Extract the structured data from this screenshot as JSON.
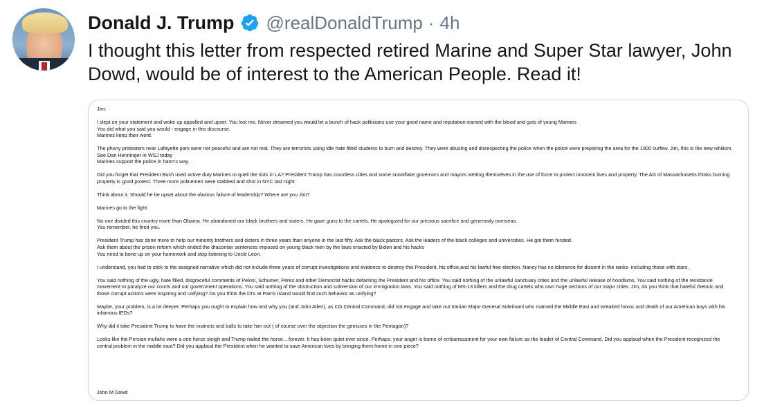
{
  "tweet": {
    "author_name": "Donald J. Trump",
    "handle": "@realDonaldTrump",
    "separator": "·",
    "time": "4h",
    "text": "I thought this letter from respected retired Marine and Super Star lawyer, John Dowd, would be of interest to the American People. Read it!",
    "verified_color": "#1da1f2"
  },
  "letter": {
    "paragraphs": [
      [
        "Jim:"
      ],
      [
        "I slept on your statement and woke up appalled and upset. You lost me. Never dreamed you would let a bunch of hack politicians use your good name and reputation-earned with the blood and guts of young Marines",
        "You did what you said you would - engage in this discourse.",
        "Marines keep their word."
      ],
      [
        "The phony protesters near Lafayette park were not peaceful and are not real. They are terrorists using idle hate filled students to burn and destroy. They were abusing and disrespecting the police when the police were preparing the area for the 1900 curfew. Jim, this is the new nihilism. See Dan Henninger in WSJ today",
        "Marines support the police in harm's way."
      ],
      [
        "Did you forget that President Bush used active duty Marines to quell the riots in LA? President Trump has countless cities and some snowflake governors and mayors wetting themselves in the use of force to protect innocent lives and property. The AG of Massachusetts thinks burning property is good protest. Three more policemen were stabbed and shot in NYC last night"
      ],
      [
        "Think about it. Should he be upset about the obvious failure of leadership? Where are you Jim?"
      ],
      [
        "Marines go to the fight."
      ],
      [
        "No one divided this country more than Obama. He abandoned our black brothers and sisters. He gave guns to the cartels. He apologized for our precious sacrifice and generosity overseas.",
        "You remember, he fired you."
      ],
      [
        "President Trump has done more to help our minority brothers and sisters in three years than anyone in the last fifty. Ask the black pastors. Ask the leaders of the black colleges and universities. He got them funded.",
        "Ask them about the prison reform which ended the draconian sentences imposed on young black men by the laws enacted by Biden and his hacks",
        "You need to bone up on your homework and stop listening to Uncle Leon."
      ],
      [
        "I understand, you had to stick to the assigned narrative which did not include three years of corrupt investigations and evidence to destroy this President, his office,and his lawful free election. Nancy has no tolerance for dissent in the ranks- including those with stars."
      ],
      [
        "You said nothing of the ugly, hate filled, disgraceful comments of Pelosi, Schumer, Perez and other Democrat hacks defaming the President and his office. You said nothing of the unlawful sanctuary cities and the unlawful release of hoodlums. You said nothing of the resistance movement to paralyze our courts and our government operations. You said nothing of the obstruction and subversion of our immigration laws. You said nothing of MS-13 killers and the drug cartels who own huge sections of our major cities. Jim, do you think that hateful rhetoric and those corrupt actions were inspiring and unifying? Do you think the DI's at Parris Island would find such behavior as unifying?"
      ],
      [
        "Maybe, your problem, is a lot deeper. Perhaps you ought to explain how and why you (and John Allen), as CG Central Command, did not engage and take out Iranian Major General Soleimani who roamed the Middle East and wreaked havoc and death of our American boys with his infamous IEDs?"
      ],
      [
        "Why did it take President Trump to have the instincts and balls to take him out ( of course over the objection the geniuses in the Pentagon)?"
      ],
      [
        "Looks like the Persian mullahs were a one horse sleigh and Trump nailed the horse....forever. It has been quiet ever since. Perhaps, your anger is borne of embarrassment for your own failure as the leader of Central Command. Did you applaud when the President recognized the central problem in the middle east? Did you applaud the President when he wanted to save American lives by bringing them home in one piece?"
      ]
    ],
    "signature": "John M Dowd"
  }
}
